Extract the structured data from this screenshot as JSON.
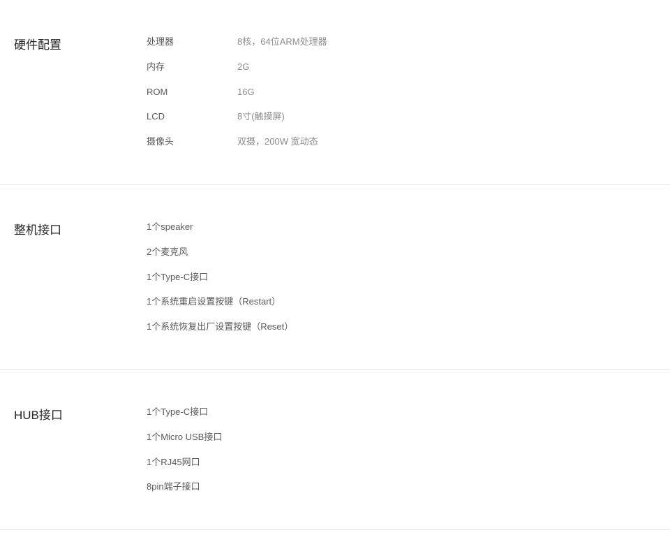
{
  "sections": {
    "hardware": {
      "title": "硬件配置",
      "rows": [
        {
          "label": "处理器",
          "value": "8核，64位ARM处理器"
        },
        {
          "label": "内存",
          "value": "2G"
        },
        {
          "label": "ROM",
          "value": "16G"
        },
        {
          "label": "LCD",
          "value": "8寸(触摸屏)"
        },
        {
          "label": "摄像头",
          "value": "双摄，200W 宽动态"
        }
      ]
    },
    "machine_ports": {
      "title": "整机接口",
      "items": [
        "1个speaker",
        "2个麦克风",
        "1个Type-C接口",
        "1个系统重启设置按键（Restart）",
        "1个系统恢复出厂设置按键（Reset）"
      ]
    },
    "hub_ports": {
      "title": "HUB接口",
      "items": [
        "1个Type-C接口",
        "1个Micro USB接口",
        "1个RJ45网口",
        "8pin端子接口"
      ]
    }
  }
}
